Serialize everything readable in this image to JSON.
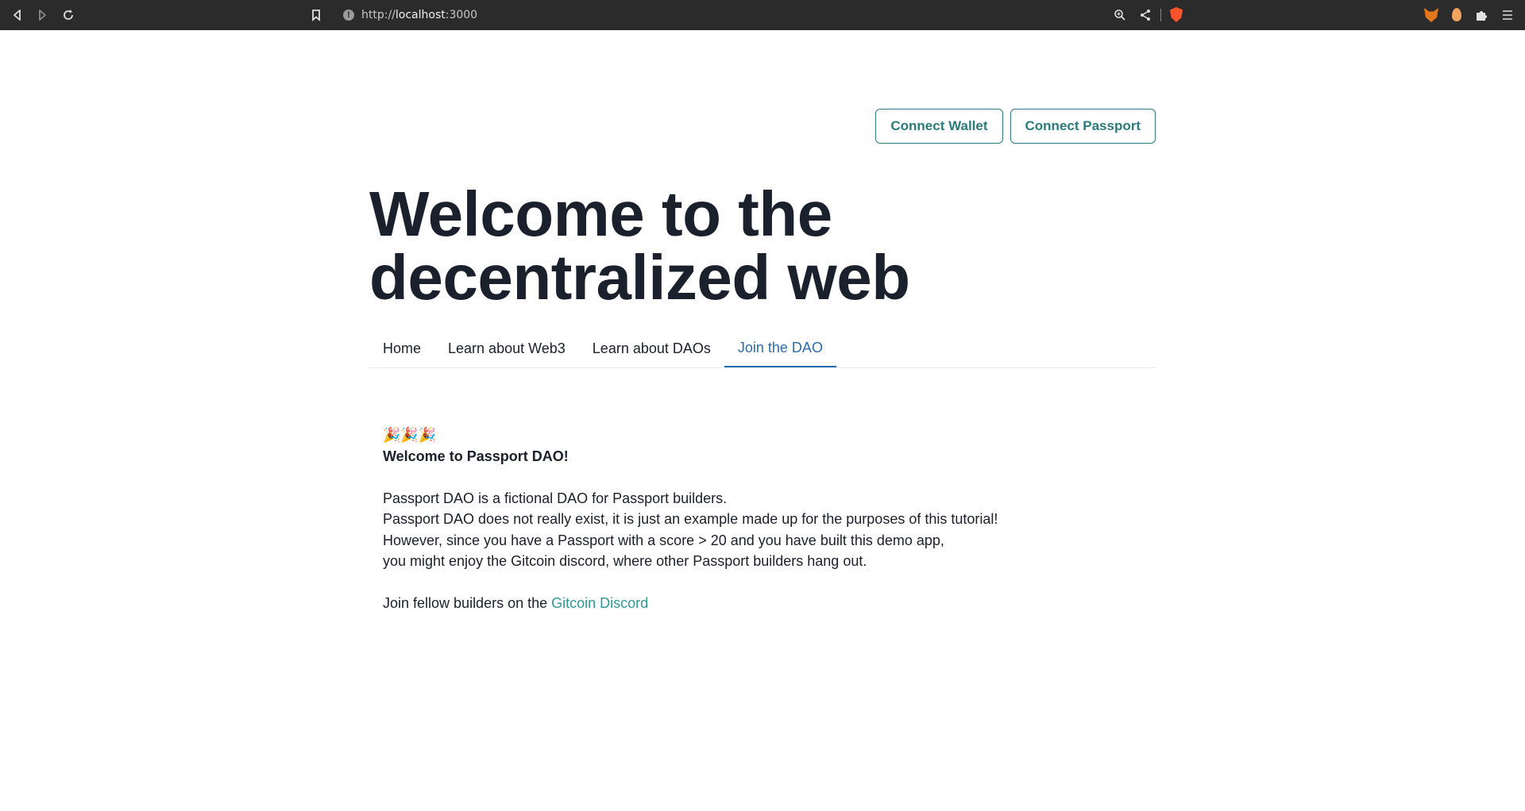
{
  "browser": {
    "url_scheme": "http://",
    "url_host": "localhost",
    "url_port": ":3000",
    "nav_icons": [
      "back-icon",
      "forward-icon",
      "reload-icon",
      "bookmark-icon"
    ],
    "right_icons": [
      "zoom-icon",
      "share-icon",
      "brave-shield-icon",
      "metamask-extension-icon",
      "extension-egg-icon",
      "puzzle-extensions-icon",
      "menu-icon"
    ]
  },
  "header": {
    "connect_wallet": "Connect Wallet",
    "connect_passport": "Connect Passport"
  },
  "hero": {
    "line1": "Welcome to the",
    "line2": "decentralized web"
  },
  "tabs": [
    {
      "label": "Home"
    },
    {
      "label": "Learn about Web3"
    },
    {
      "label": "Learn about DAOs"
    },
    {
      "label": "Join the DAO",
      "active": true
    }
  ],
  "content": {
    "emoji": "🎉🎉🎉",
    "heading": "Welcome to Passport DAO!",
    "line1": "Passport DAO is a fictional DAO for Passport builders.",
    "line2": "Passport DAO does not really exist, it is just an example made up for the purposes of this tutorial!",
    "line3": "However, since you have a Passport with a score > 20 and you have built this demo app,",
    "line4": "you might enjoy the Gitcoin discord, where other Passport builders hang out.",
    "join_text": "Join fellow builders on the ",
    "link_text": "Gitcoin Discord"
  },
  "colors": {
    "accent": "#2c7a7b",
    "active_tab": "#2b6cb0",
    "link": "#319795",
    "text": "#1a202c"
  }
}
